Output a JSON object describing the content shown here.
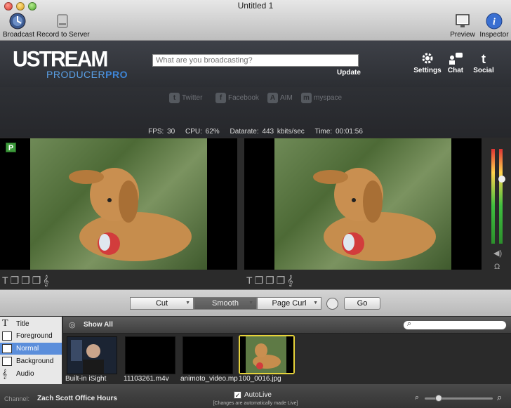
{
  "window": {
    "title": "Untitled 1"
  },
  "toolbar": {
    "broadcast": "Broadcast",
    "record": "Record to Server",
    "preview": "Preview",
    "inspector": "Inspector"
  },
  "header": {
    "logo_main": "USTREAM",
    "logo_sub_a": "PRODUCER",
    "logo_sub_b": "PRO",
    "status_placeholder": "What are you broadcasting?",
    "update": "Update",
    "settings": "Settings",
    "chat": "Chat",
    "social": "Social"
  },
  "social": {
    "twitter": "Twitter",
    "facebook": "Facebook",
    "aim": "AIM",
    "myspace": "myspace"
  },
  "stats": {
    "fps": "FPS: 30",
    "cpu": "CPU: 62%",
    "datarate": "Datarate: 443 kbits/sec",
    "time": "Time: 00:01:56"
  },
  "preview_badge": "P",
  "transitions": {
    "cut": "Cut",
    "smooth": "Smooth",
    "pagecurl": "Page Curl",
    "go": "Go"
  },
  "sidebar": {
    "items": [
      {
        "label": "Title"
      },
      {
        "label": "Foreground"
      },
      {
        "label": "Normal"
      },
      {
        "label": "Background"
      },
      {
        "label": "Audio"
      }
    ]
  },
  "media": {
    "show_all": "Show All",
    "items": [
      {
        "label": "Built-in iSight"
      },
      {
        "label": "11103261.m4v"
      },
      {
        "label": "animoto_video.mp"
      },
      {
        "label": "100_0016.jpg"
      }
    ]
  },
  "bottom": {
    "channel_label": "Channel:",
    "channel_name": "Zach Scott Office Hours",
    "autolive": "AutoLive",
    "autolive_note": "[Changes are automatically made Live]"
  },
  "colors": {
    "accent": "#5b8edb",
    "highlight": "#e6d23a",
    "live_green": "#3d9a3b"
  }
}
